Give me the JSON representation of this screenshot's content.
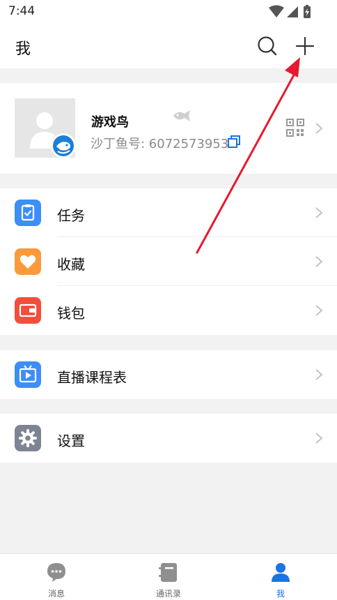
{
  "status_bar": {
    "time": "7:44"
  },
  "header": {
    "title": "我"
  },
  "profile": {
    "nickname": "游戏鸟",
    "account_label": "沙丁鱼号: ",
    "account_id": "6072573953"
  },
  "menu": {
    "group1": [
      {
        "label": "任务",
        "icon": "clipboard-check-icon",
        "color": "#3d8ef7"
      },
      {
        "label": "收藏",
        "icon": "heart-icon",
        "color": "#fb9a3b"
      },
      {
        "label": "钱包",
        "icon": "wallet-icon",
        "color": "#f24e3b"
      }
    ],
    "group2": [
      {
        "label": "直播课程表",
        "icon": "tv-play-icon",
        "color": "#3d8ef7"
      }
    ],
    "group3": [
      {
        "label": "设置",
        "icon": "gear-icon",
        "color": "#7e8491"
      }
    ]
  },
  "bottom_nav": {
    "tabs": [
      {
        "label": "消息",
        "icon": "chat-bubble-icon",
        "active": false
      },
      {
        "label": "通讯录",
        "icon": "address-book-icon",
        "active": false
      },
      {
        "label": "我",
        "icon": "person-icon",
        "active": true
      }
    ]
  },
  "colors": {
    "accent": "#1a73e8",
    "inactive": "#8f8f8f",
    "annotation": "#e8192c"
  }
}
